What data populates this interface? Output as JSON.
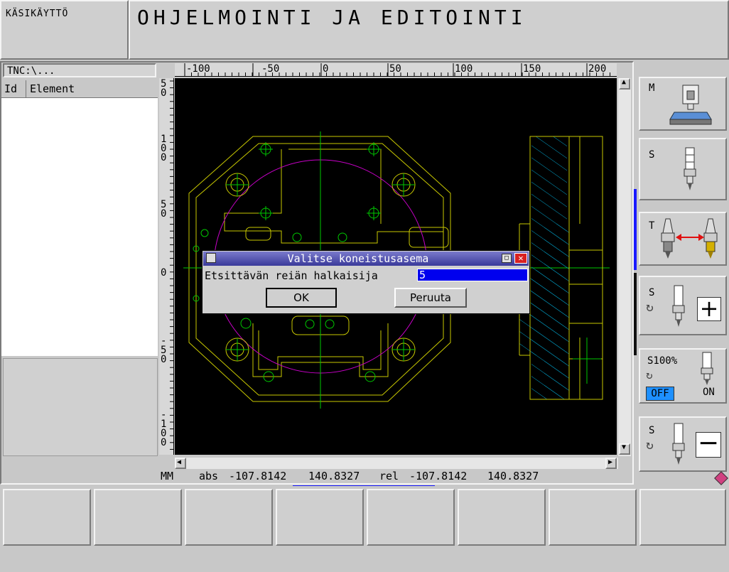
{
  "mode": {
    "label": "KÄSIKÄYTTÖ"
  },
  "header": {
    "title": "OHJELMOINTI JA EDITOINTI"
  },
  "left_panel": {
    "path": "TNC:\\...",
    "columns": [
      "Id",
      "Element"
    ]
  },
  "ruler": {
    "x_ticks": [
      "-100",
      "-50",
      "0",
      "50",
      "100",
      "150",
      "200"
    ],
    "y_ticks": [
      "50",
      "100",
      "50",
      "0",
      "-50",
      "-100"
    ]
  },
  "status_bar": {
    "unit": "MM",
    "abs_label": "abs",
    "abs_x": "-107.8142",
    "abs_y": "140.8327",
    "rel_label": "rel",
    "rel_x": "-107.8142",
    "rel_y": "140.8327"
  },
  "dialog": {
    "title": "Valitse koneistusasema",
    "field_label": "Etsittävän reiän halkaisija",
    "field_value": "5",
    "ok_label": "OK",
    "cancel_label": "Peruuta"
  },
  "sidebar": {
    "m_label": "M",
    "s1_label": "S",
    "t_label": "T",
    "s2_label": "S",
    "s100_label": "S100%",
    "off_label": "OFF",
    "on_label": "ON",
    "s3_label": "S"
  },
  "colors": {
    "drawing_bg": "#000000",
    "geometry": "#c8c800",
    "centerline": "#00c800",
    "circle": "#c800c8",
    "hatch": "#00a0c8",
    "selection": "#0000ff",
    "off_badge": "#1e90ff",
    "arrow": "#e01010"
  }
}
